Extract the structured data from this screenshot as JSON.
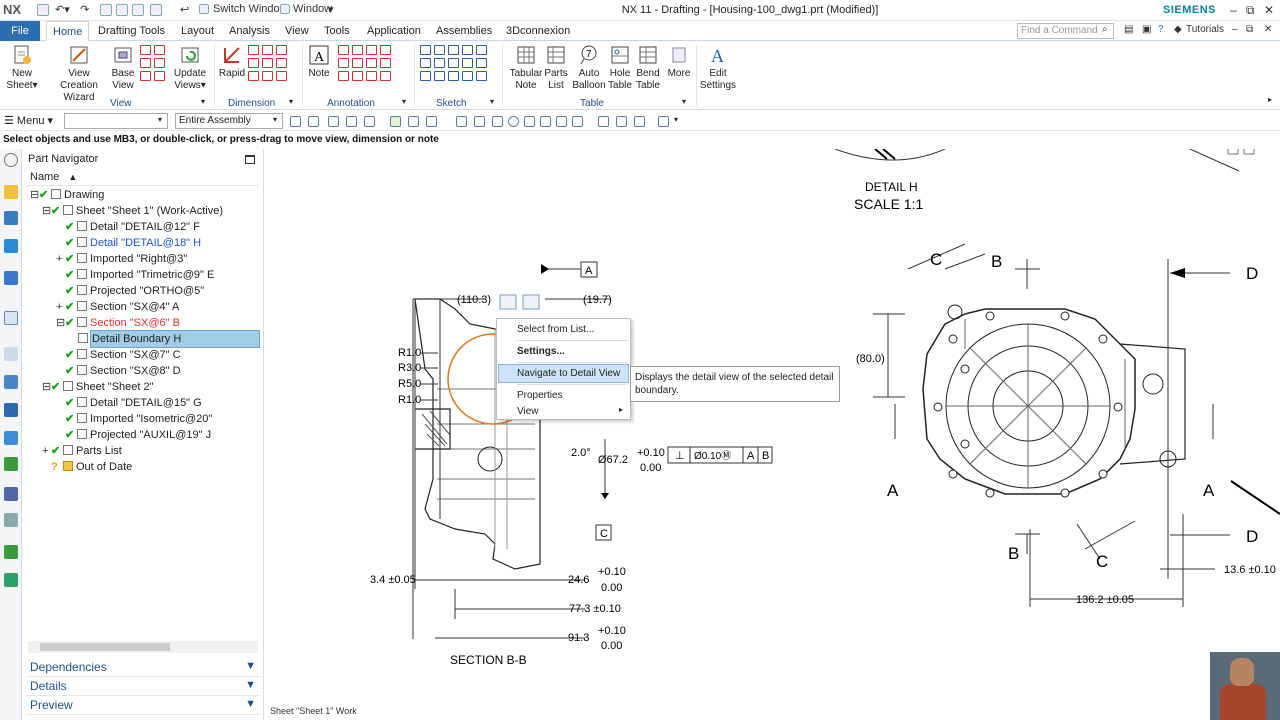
{
  "app": {
    "logo": "NX",
    "title": "NX 11 - Drafting - [Housing-100_dwg1.prt (Modified)]",
    "brand": "SIEMENS",
    "switch_window": "Switch Window",
    "window": "Window"
  },
  "menu": {
    "file": "File",
    "tabs": [
      "Home",
      "Drafting Tools",
      "Layout",
      "Analysis",
      "View",
      "Tools",
      "Application",
      "Assemblies",
      "3Dconnexion"
    ],
    "find_placeholder": "Find a Command",
    "tutorials": "Tutorials"
  },
  "ribbon": {
    "buttons": {
      "new_sheet": [
        "New",
        "Sheet"
      ],
      "view_wizard": [
        "View Creation",
        "Wizard"
      ],
      "base_view": [
        "Base",
        "View"
      ],
      "update_views": [
        "Update",
        "Views"
      ],
      "rapid": "Rapid",
      "note": "Note",
      "tabular_note": [
        "Tabular",
        "Note"
      ],
      "parts_list": [
        "Parts",
        "List"
      ],
      "auto_balloon": [
        "Auto",
        "Balloon"
      ],
      "hole_table": [
        "Hole",
        "Table"
      ],
      "bend_table": [
        "Bend",
        "Table"
      ],
      "more": "More",
      "edit_settings": [
        "Edit",
        "Settings"
      ]
    },
    "groups": {
      "view": "View",
      "dimension": "Dimension",
      "annotation": "Annotation",
      "sketch": "Sketch",
      "table": "Table"
    }
  },
  "toolbar": {
    "menu": "Menu",
    "filter": "",
    "scope": "Entire Assembly"
  },
  "status": "Select objects and use MB3, or double-click, or press-drag to move view, dimension or note",
  "navigator": {
    "title": "Part Navigator",
    "column": "Name",
    "items": [
      {
        "label": "Drawing"
      },
      {
        "label": "Sheet \"Sheet 1\" (Work-Active)"
      },
      {
        "label": "Detail \"DETAIL@12\" F"
      },
      {
        "label": "Detail \"DETAIL@18\" H"
      },
      {
        "label": "Imported \"Right@3\""
      },
      {
        "label": "Imported \"Trimetric@9\" E"
      },
      {
        "label": "Projected \"ORTHO@5\""
      },
      {
        "label": "Section \"SX@4\" A"
      },
      {
        "label": "Section \"SX@6\" B"
      },
      {
        "label": "Detail Boundary H"
      },
      {
        "label": "Section \"SX@7\" C"
      },
      {
        "label": "Section \"SX@8\" D"
      },
      {
        "label": "Sheet \"Sheet 2\""
      },
      {
        "label": "Detail \"DETAIL@15\" G"
      },
      {
        "label": "Imported \"Isometric@20\""
      },
      {
        "label": "Projected \"AUXIL@19\" J"
      },
      {
        "label": "Parts List"
      },
      {
        "label": "Out of Date"
      }
    ],
    "panels": [
      "Dependencies",
      "Details",
      "Preview"
    ]
  },
  "context_menu": {
    "items": [
      "Select from List...",
      "Settings...",
      "Navigate to Detail View",
      "Properties",
      "View"
    ],
    "tooltip": "Displays the detail view of the selected detail boundary."
  },
  "drawing": {
    "detail_title": "DETAIL H",
    "detail_scale": "SCALE 1:1",
    "section_title": "SECTION B-B",
    "dims": {
      "d110": "(110.3)",
      "d19": "(19.7)",
      "r1a": "R1.0",
      "r3": "R3.0",
      "r5": "R5.0",
      "r1b": "R1.0",
      "d2": "2.0°",
      "d67": "Ø67.2",
      "tol_plus": "+0.10",
      "tol_zero": "0.00",
      "fcf_tol": "Ø0.10Ⓜ",
      "d34": "3.4 ±0.05",
      "d246": "24.6",
      "d773": "77.3 ±0.10",
      "d913": "91.3",
      "d80": "(80.0)",
      "d1362": "136.2 ±0.05",
      "d136": "13.6 ±0.10"
    },
    "datums": {
      "a": "A",
      "b": "B",
      "c": "C",
      "perp": "⊥"
    },
    "section_labels": {
      "c1": "C",
      "b1": "B",
      "d1": "D",
      "a1": "A",
      "a2": "A",
      "b2": "B",
      "c2": "C",
      "d2": "D"
    }
  },
  "sheet_label": "Sheet \"Sheet 1\" Work"
}
